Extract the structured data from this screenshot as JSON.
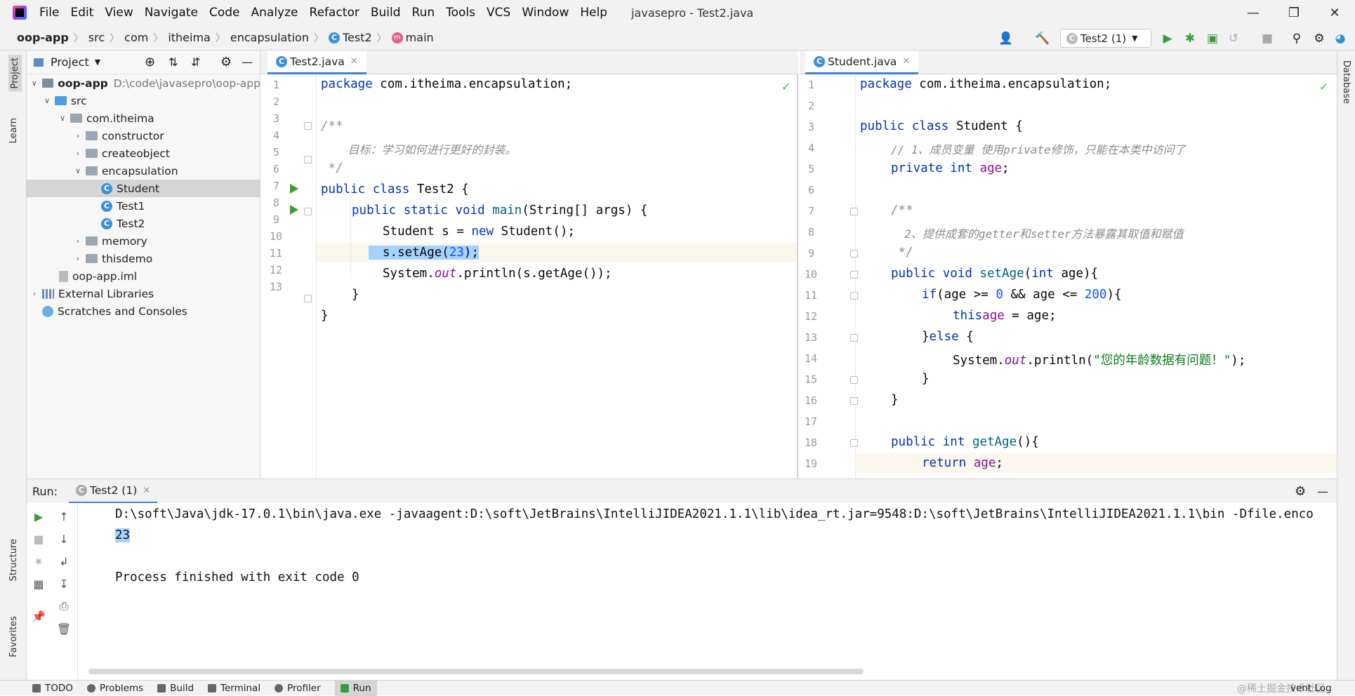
{
  "window": {
    "title": "javasepro - Test2.java"
  },
  "menu": [
    "File",
    "Edit",
    "View",
    "Navigate",
    "Code",
    "Analyze",
    "Refactor",
    "Build",
    "Run",
    "Tools",
    "VCS",
    "Window",
    "Help"
  ],
  "breadcrumb": [
    "oop-app",
    "src",
    "com",
    "itheima",
    "encapsulation",
    "Test2",
    "main"
  ],
  "toolbar": {
    "run_config": "Test2 (1)"
  },
  "stripes": {
    "left_top": [
      "Project",
      "Learn"
    ],
    "left_bottom": [
      "Structure",
      "Favorites"
    ],
    "right": [
      "Database"
    ]
  },
  "project": {
    "header": "Project",
    "root_path": "D:\\code\\javasepro\\oop-app",
    "tree": [
      {
        "label": "oop-app"
      },
      {
        "label": "src"
      },
      {
        "label": "com.itheima"
      },
      {
        "label": "constructor"
      },
      {
        "label": "createobject"
      },
      {
        "label": "encapsulation"
      },
      {
        "label": "Student"
      },
      {
        "label": "Test1"
      },
      {
        "label": "Test2"
      },
      {
        "label": "memory"
      },
      {
        "label": "thisdemo"
      },
      {
        "label": "oop-app.iml"
      },
      {
        "label": "External Libraries"
      },
      {
        "label": "Scratches and Consoles"
      }
    ]
  },
  "editor_left": {
    "tab": "Test2.java",
    "line_numbers": [
      "1",
      "2",
      "3",
      "4",
      "5",
      "6",
      "7",
      "8",
      "9",
      "10",
      "11",
      "12",
      "13"
    ],
    "code": {
      "l1a": "package ",
      "l1b": "com.itheima.encapsulation;",
      "l3": "/**",
      "l4": "    目标：学习如何进行更好的封装。",
      "l5": " */",
      "l6a": "public class ",
      "l6b": "Test2 {",
      "l7a": "public static void ",
      "l7b": "main",
      "l7c": "(String[] args) {",
      "l8a": "Student s = ",
      "l8b": "new ",
      "l8c": "Student();",
      "l9a": "s.setAge(",
      "l9b": "23",
      "l9c": ");",
      "l10a": "System.",
      "l10b": "out",
      "l10c": ".println(s.getAge());",
      "l11": "}",
      "l12": "}"
    }
  },
  "editor_right": {
    "tab": "Student.java",
    "line_numbers": [
      "1",
      "2",
      "3",
      "4",
      "5",
      "6",
      "7",
      "8",
      "9",
      "10",
      "11",
      "12",
      "13",
      "14",
      "15",
      "16",
      "17",
      "18",
      "19"
    ],
    "code": {
      "l1a": "package ",
      "l1b": "com.itheima.encapsulation;",
      "l3a": "public class ",
      "l3b": "Student {",
      "l4": "// 1、成员变量 使用private修饰，只能在本类中访问了",
      "l5a": "private int ",
      "l5b": "age",
      "l5c": ";",
      "l7": "/**",
      "l8": "  2、提供成套的getter和setter方法暴露其取值和赋值",
      "l9": " */",
      "l10a": "public void ",
      "l10b": "setAge",
      "l10c": "(",
      "l10d": "int ",
      "l10e": "age){",
      "l11a": "if",
      "l11b": "(age >= ",
      "l11c": "0",
      "l11d": " && age <= ",
      "l11e": "200",
      "l11f": "){",
      "l12a": "this",
      ".l12b": ".",
      "l12c": "age",
      "l12d": " = age;",
      "l13a": "}",
      "l13b": "else ",
      "l13c": "{",
      "l14a": "System.",
      "l14b": "out",
      "l14c": ".println(",
      "l14d": "\"您的年龄数据有问题！\"",
      "l14e": ");",
      "l15": "}",
      "l16": "}",
      "l18a": "public int ",
      "l18b": "getAge",
      "l18c": "(){",
      "l19a": "return ",
      "l19b": "age",
      "l19c": ";"
    }
  },
  "run": {
    "label": "Run:",
    "tab": "Test2 (1)",
    "console": [
      "D:\\soft\\Java\\jdk-17.0.1\\bin\\java.exe -javaagent:D:\\soft\\JetBrains\\IntelliJIDEA2021.1.1\\lib\\idea_rt.jar=9548:D:\\soft\\JetBrains\\IntelliJIDEA2021.1.1\\bin -Dfile.enco",
      "23",
      "",
      "Process finished with exit code 0"
    ]
  },
  "statusbar": {
    "items": [
      "TODO",
      "Problems",
      "Build",
      "Terminal",
      "Profiler",
      "Run"
    ],
    "right": "vent Log",
    "watermark": "@稀土掘金技术社区"
  }
}
